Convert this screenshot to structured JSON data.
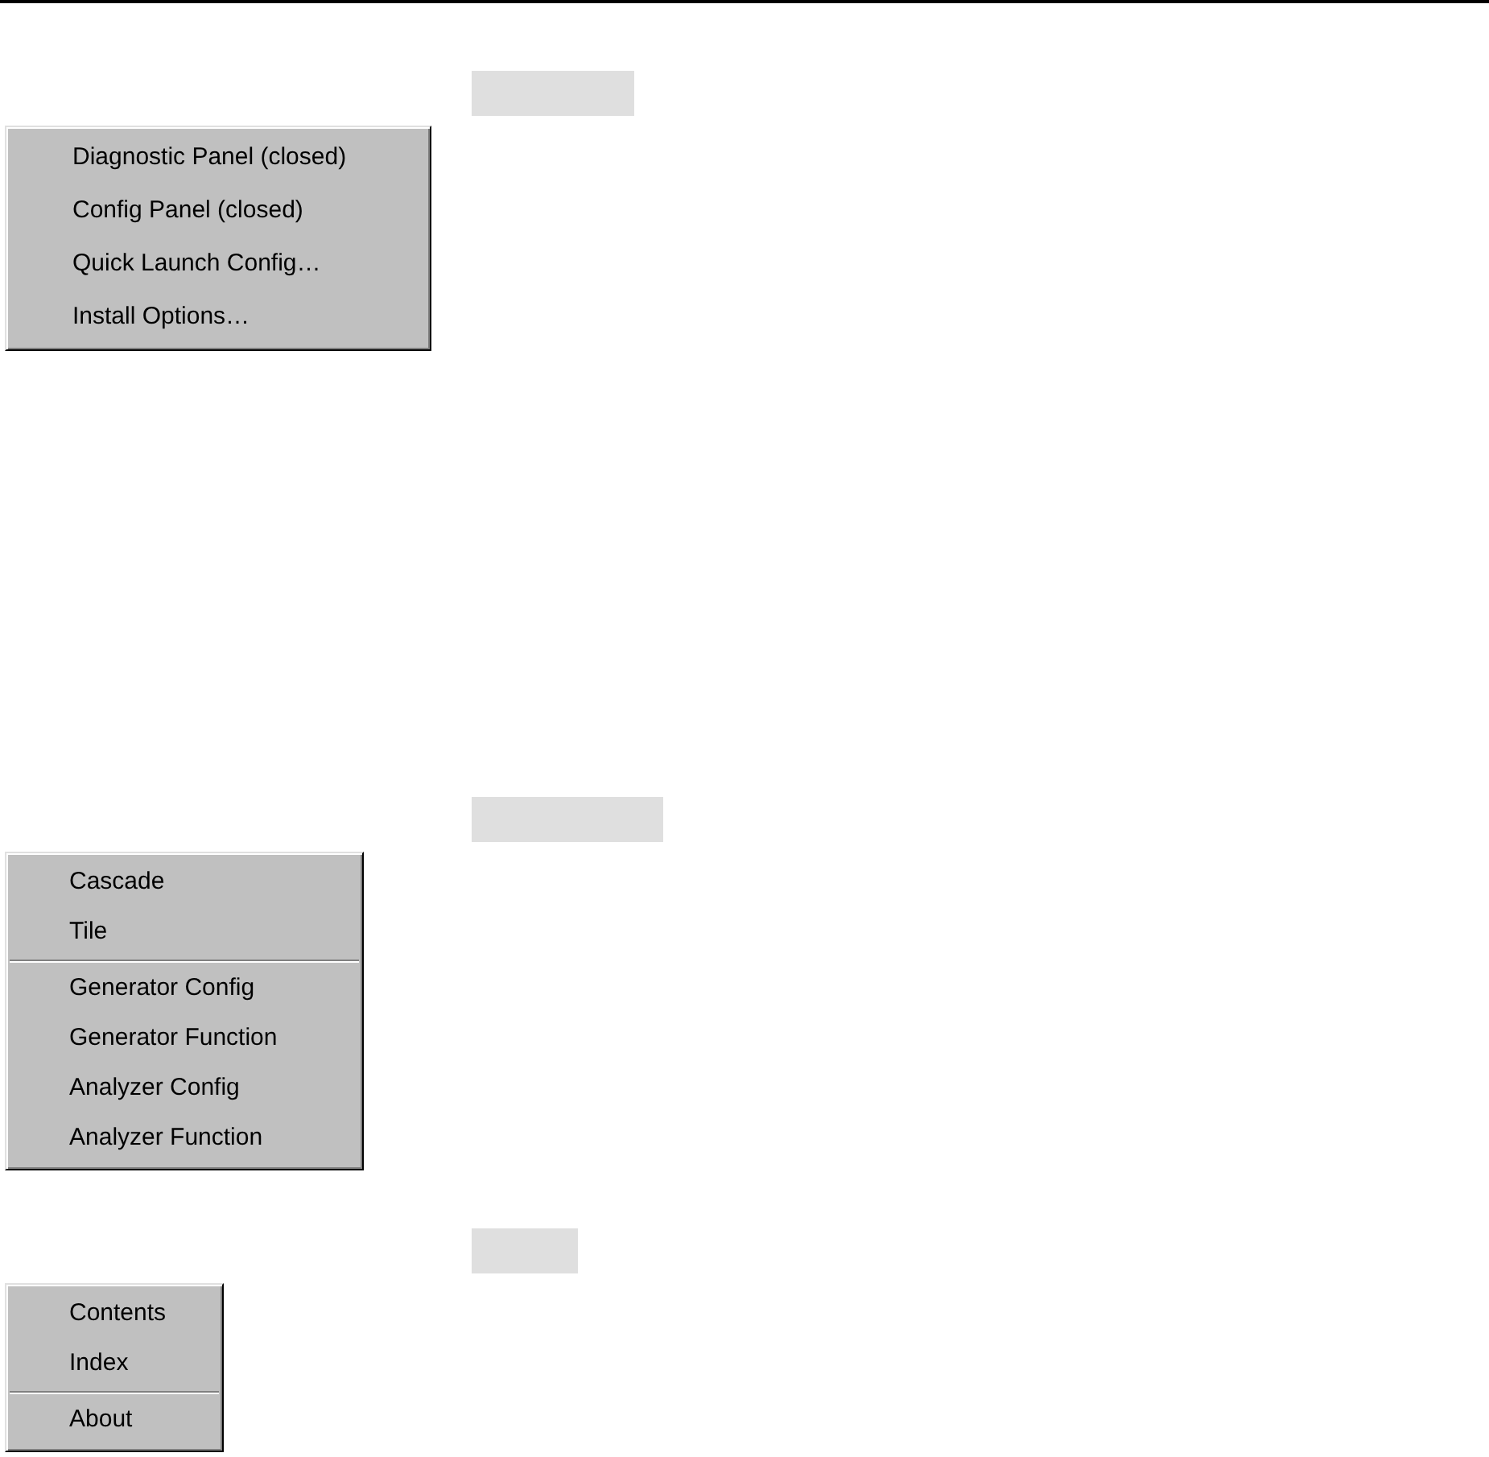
{
  "menus": [
    {
      "items": [
        {
          "kind": "item",
          "label": "Diagnostic Panel (closed)"
        },
        {
          "kind": "item",
          "label": "Config Panel (closed)"
        },
        {
          "kind": "item",
          "label": "Quick Launch Config…"
        },
        {
          "kind": "item",
          "label": "Install Options…"
        }
      ]
    },
    {
      "items": [
        {
          "kind": "item",
          "label": "Cascade"
        },
        {
          "kind": "item",
          "label": "Tile"
        },
        {
          "kind": "separator"
        },
        {
          "kind": "item",
          "label": "Generator Config"
        },
        {
          "kind": "item",
          "label": "Generator Function"
        },
        {
          "kind": "item",
          "label": "Analyzer Config"
        },
        {
          "kind": "item",
          "label": "Analyzer Function"
        }
      ]
    },
    {
      "items": [
        {
          "kind": "item",
          "label": "Contents"
        },
        {
          "kind": "item",
          "label": "Index"
        },
        {
          "kind": "separator"
        },
        {
          "kind": "item",
          "label": "About"
        }
      ]
    }
  ]
}
